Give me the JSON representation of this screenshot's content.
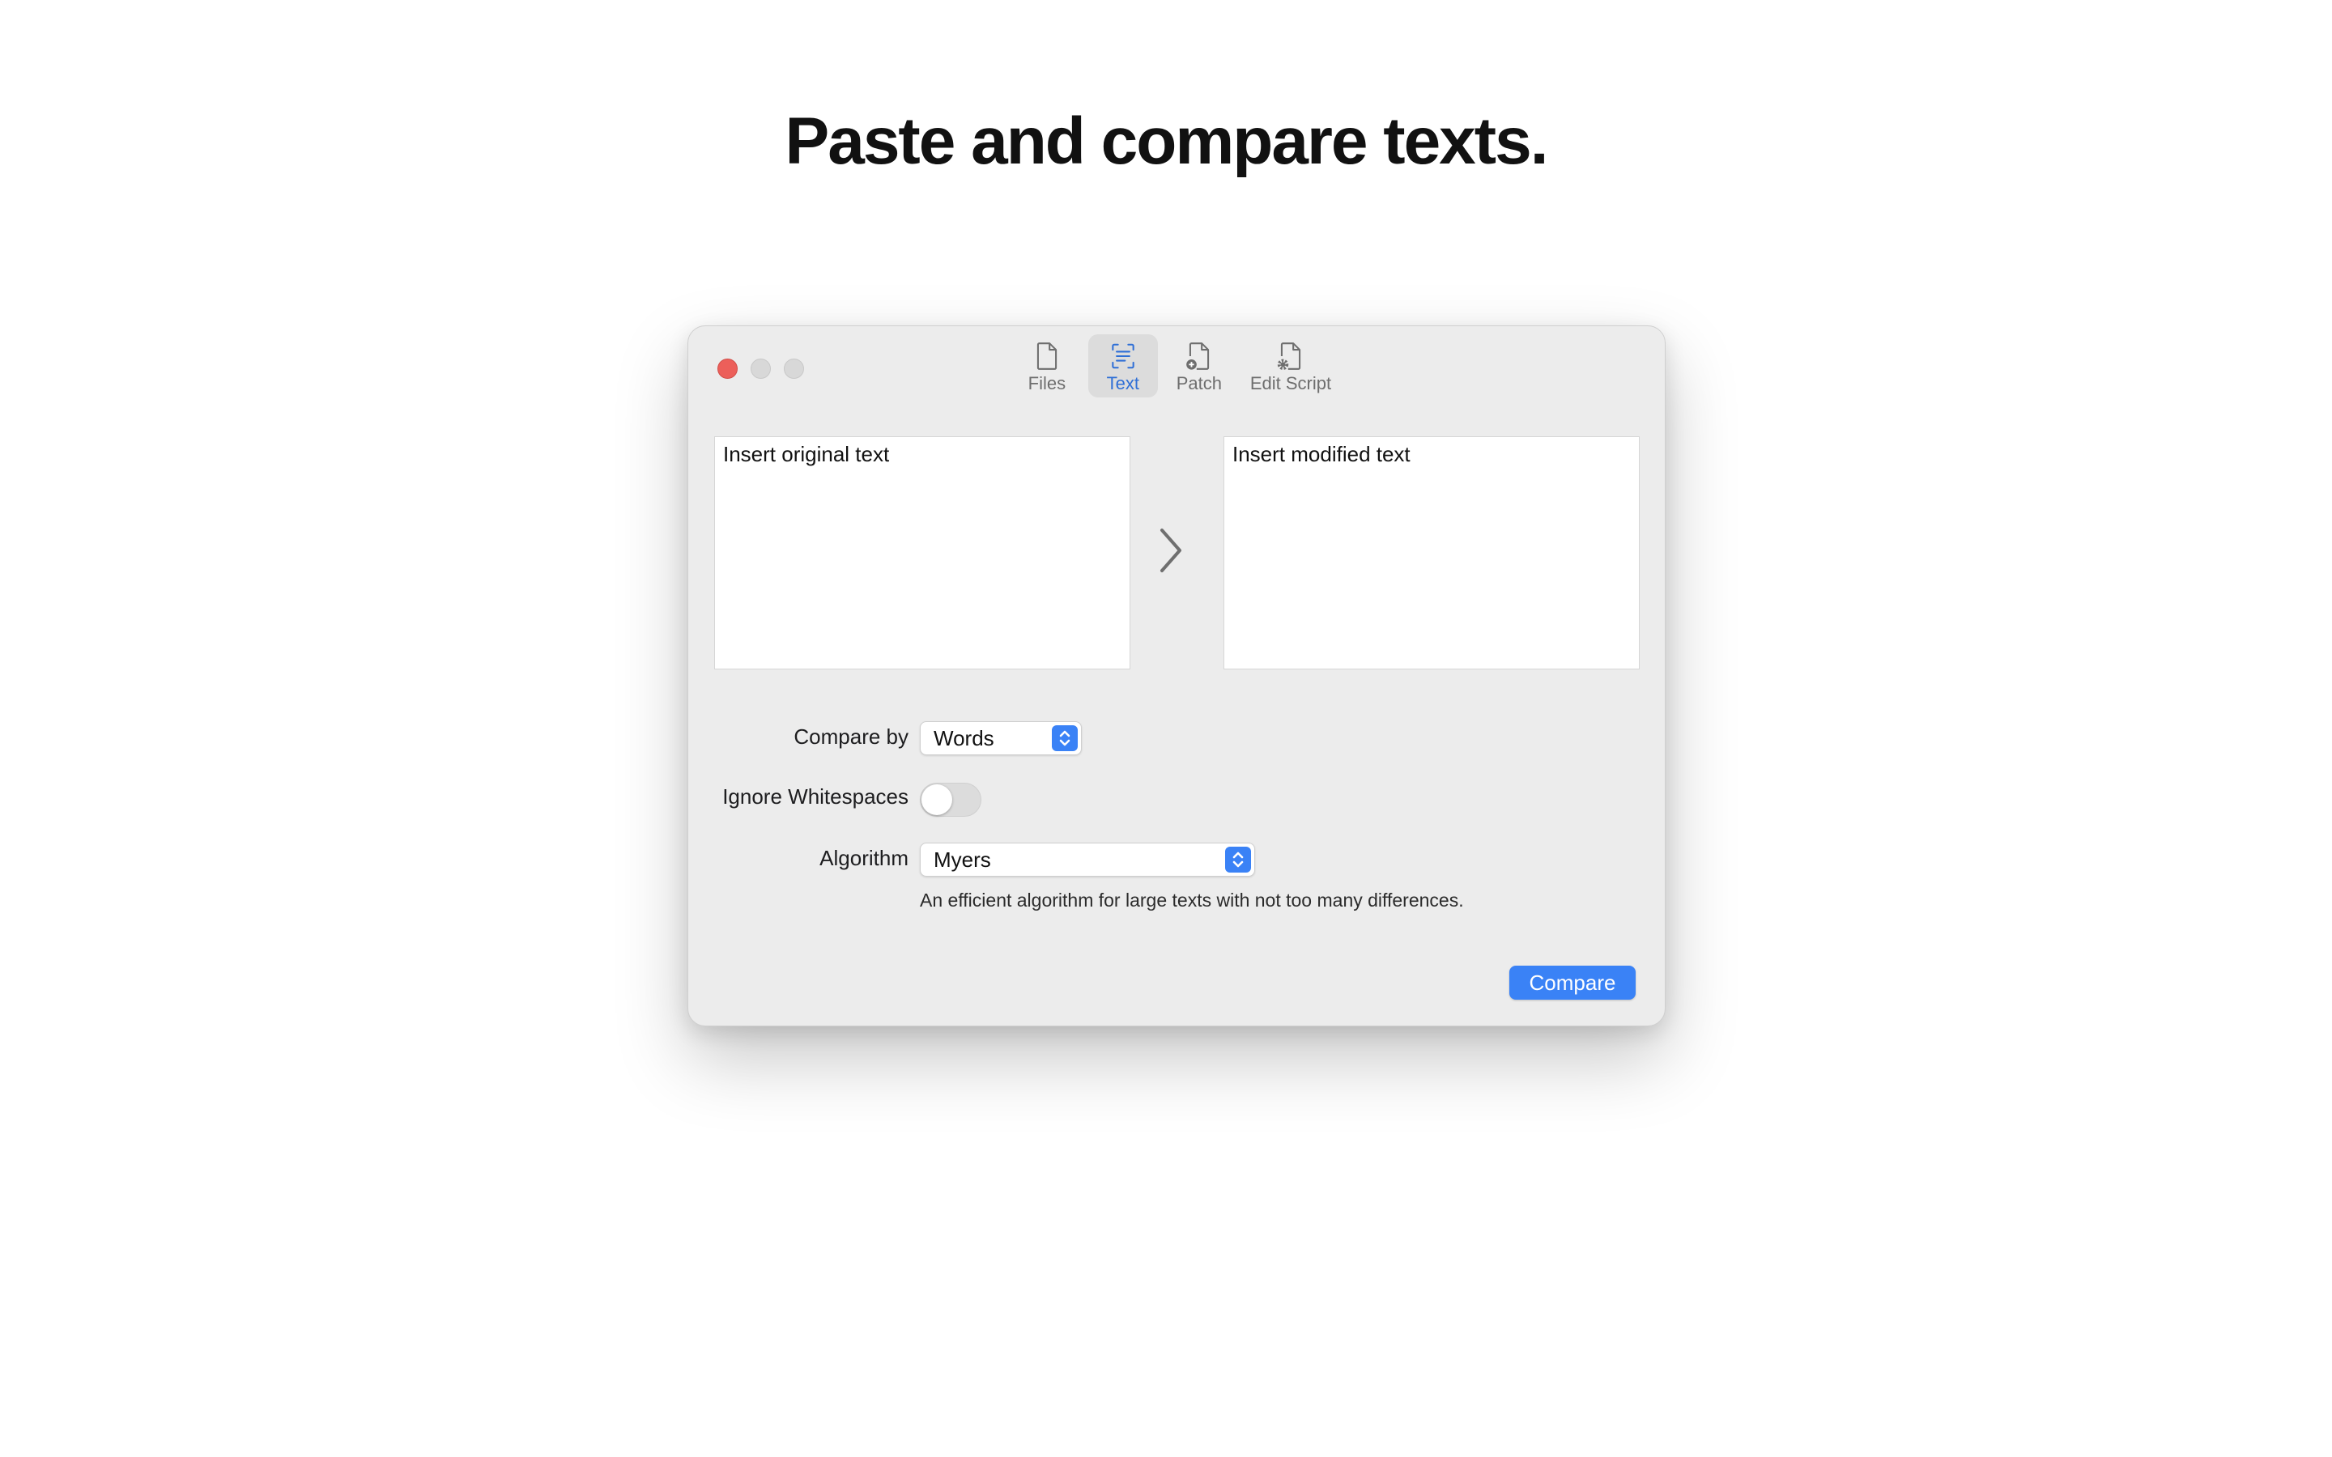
{
  "page": {
    "title": "Paste and compare texts."
  },
  "window": {
    "toolbar": [
      {
        "label": "Files",
        "icon": "file-icon",
        "active": false
      },
      {
        "label": "Text",
        "icon": "text-icon",
        "active": true
      },
      {
        "label": "Patch",
        "icon": "file-plus-icon",
        "active": false
      },
      {
        "label": "Edit Script",
        "icon": "file-gear-icon",
        "active": false
      }
    ],
    "original_placeholder": "Insert original text",
    "modified_placeholder": "Insert modified text",
    "compare_by": {
      "label": "Compare by",
      "value": "Words"
    },
    "ignore_whitespaces": {
      "label": "Ignore Whitespaces",
      "enabled": false
    },
    "algorithm": {
      "label": "Algorithm",
      "value": "Myers",
      "description": "An efficient algorithm for large texts with not too many differences."
    },
    "compare_button": "Compare"
  },
  "colors": {
    "accent": "#3a82f6",
    "close": "#ec5f5a",
    "window_bg": "#ececec"
  }
}
